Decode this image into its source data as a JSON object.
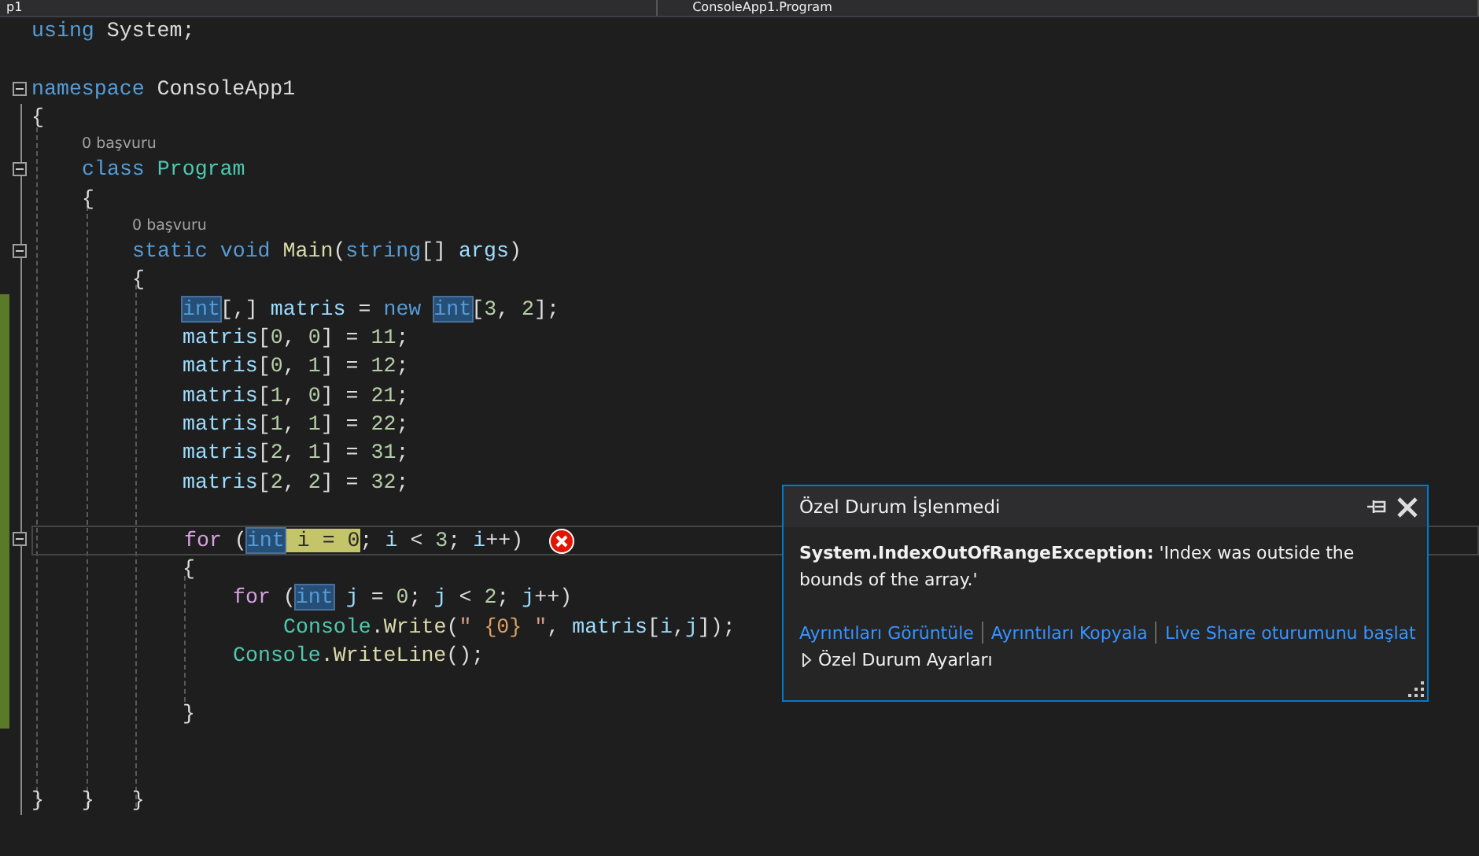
{
  "nav_bar": {
    "project": "p1",
    "class": "ConsoleApp1.Program"
  },
  "lines": [
    {
      "kind": "code",
      "changed": false,
      "tokens": [
        {
          "text": "using",
          "kind": "keyword"
        },
        {
          "text": " System;",
          "kind": "plain"
        }
      ]
    },
    {
      "kind": "blank",
      "changed": false
    },
    {
      "kind": "code",
      "expanded": true,
      "changed": false,
      "tokens": [
        {
          "text": "namespace",
          "kind": "keyword"
        },
        {
          "text": " ConsoleApp1",
          "kind": "plain"
        }
      ]
    },
    {
      "kind": "code",
      "changed": false,
      "tokens": [
        {
          "text": "{",
          "kind": "plain"
        }
      ],
      "children": [
        {
          "kind": "codelens",
          "changed": false,
          "text": "0 başvuru"
        },
        {
          "kind": "code",
          "expanded": true,
          "changed": false,
          "tokens": [
            {
              "text": "class",
              "kind": "keyword"
            },
            {
              "text": " Program",
              "kind": "type"
            }
          ]
        },
        {
          "kind": "code",
          "changed": false,
          "tokens": [
            {
              "text": "{",
              "kind": "plain"
            }
          ],
          "children": [
            {
              "kind": "codelens",
              "changed": false,
              "text": "0 başvuru"
            },
            {
              "kind": "code",
              "expanded": true,
              "changed": false,
              "tokens": [
                {
                  "text": "static void",
                  "kind": "keyword"
                },
                {
                  "text": " Main",
                  "kind": "method"
                },
                {
                  "text": "(",
                  "kind": "plain"
                },
                {
                  "text": "string",
                  "kind": "keyword"
                },
                {
                  "text": "[] ",
                  "kind": "plain"
                },
                {
                  "text": "args",
                  "kind": "ident"
                },
                {
                  "text": ")",
                  "kind": "plain"
                }
              ]
            },
            {
              "kind": "code",
              "changed": false,
              "tokens": [
                {
                  "text": "{",
                  "kind": "plain"
                }
              ],
              "children": [
                {
                  "kind": "code",
                  "changed": true,
                  "tokens": [
                    {
                      "text": "int",
                      "kind": "reference"
                    },
                    {
                      "text": "[,] ",
                      "kind": "plain"
                    },
                    {
                      "text": "matris",
                      "kind": "ident"
                    },
                    {
                      "text": " = ",
                      "kind": "plain"
                    },
                    {
                      "text": "new ",
                      "kind": "keyword"
                    },
                    {
                      "text": "int",
                      "kind": "reference"
                    },
                    {
                      "text": "[",
                      "kind": "plain"
                    },
                    {
                      "text": "3",
                      "kind": "number"
                    },
                    {
                      "text": ", ",
                      "kind": "plain"
                    },
                    {
                      "text": "2",
                      "kind": "number"
                    },
                    {
                      "text": "];",
                      "kind": "plain"
                    }
                  ]
                },
                {
                  "kind": "code",
                  "changed": true,
                  "tokens": [
                    {
                      "text": "matris",
                      "kind": "ident"
                    },
                    {
                      "text": "[",
                      "kind": "plain"
                    },
                    {
                      "text": "0",
                      "kind": "number"
                    },
                    {
                      "text": ", ",
                      "kind": "plain"
                    },
                    {
                      "text": "0",
                      "kind": "number"
                    },
                    {
                      "text": "] = ",
                      "kind": "plain"
                    },
                    {
                      "text": "11",
                      "kind": "number"
                    },
                    {
                      "text": ";",
                      "kind": "plain"
                    }
                  ]
                },
                {
                  "kind": "code",
                  "changed": true,
                  "tokens": [
                    {
                      "text": "matris",
                      "kind": "ident"
                    },
                    {
                      "text": "[",
                      "kind": "plain"
                    },
                    {
                      "text": "0",
                      "kind": "number"
                    },
                    {
                      "text": ", ",
                      "kind": "plain"
                    },
                    {
                      "text": "1",
                      "kind": "number"
                    },
                    {
                      "text": "] = ",
                      "kind": "plain"
                    },
                    {
                      "text": "12",
                      "kind": "number"
                    },
                    {
                      "text": ";",
                      "kind": "plain"
                    }
                  ]
                },
                {
                  "kind": "code",
                  "changed": true,
                  "tokens": [
                    {
                      "text": "matris",
                      "kind": "ident"
                    },
                    {
                      "text": "[",
                      "kind": "plain"
                    },
                    {
                      "text": "1",
                      "kind": "number"
                    },
                    {
                      "text": ", ",
                      "kind": "plain"
                    },
                    {
                      "text": "0",
                      "kind": "number"
                    },
                    {
                      "text": "] = ",
                      "kind": "plain"
                    },
                    {
                      "text": "21",
                      "kind": "number"
                    },
                    {
                      "text": ";",
                      "kind": "plain"
                    }
                  ]
                },
                {
                  "kind": "code",
                  "changed": true,
                  "tokens": [
                    {
                      "text": "matris",
                      "kind": "ident"
                    },
                    {
                      "text": "[",
                      "kind": "plain"
                    },
                    {
                      "text": "1",
                      "kind": "number"
                    },
                    {
                      "text": ", ",
                      "kind": "plain"
                    },
                    {
                      "text": "1",
                      "kind": "number"
                    },
                    {
                      "text": "] = ",
                      "kind": "plain"
                    },
                    {
                      "text": "22",
                      "kind": "number"
                    },
                    {
                      "text": ";",
                      "kind": "plain"
                    }
                  ]
                },
                {
                  "kind": "code",
                  "changed": true,
                  "tokens": [
                    {
                      "text": "matris",
                      "kind": "ident"
                    },
                    {
                      "text": "[",
                      "kind": "plain"
                    },
                    {
                      "text": "2",
                      "kind": "number"
                    },
                    {
                      "text": ", ",
                      "kind": "plain"
                    },
                    {
                      "text": "1",
                      "kind": "number"
                    },
                    {
                      "text": "] = ",
                      "kind": "plain"
                    },
                    {
                      "text": "31",
                      "kind": "number"
                    },
                    {
                      "text": ";",
                      "kind": "plain"
                    }
                  ]
                },
                {
                  "kind": "code",
                  "changed": true,
                  "tokens": [
                    {
                      "text": "matris",
                      "kind": "ident"
                    },
                    {
                      "text": "[",
                      "kind": "plain"
                    },
                    {
                      "text": "2",
                      "kind": "number"
                    },
                    {
                      "text": ", ",
                      "kind": "plain"
                    },
                    {
                      "text": "2",
                      "kind": "number"
                    },
                    {
                      "text": "] = ",
                      "kind": "plain"
                    },
                    {
                      "text": "32",
                      "kind": "number"
                    },
                    {
                      "text": ";",
                      "kind": "plain"
                    }
                  ]
                },
                {
                  "kind": "blank",
                  "changed": true
                },
                {
                  "kind": "code",
                  "expanded": true,
                  "changed": true,
                  "current": true,
                  "error": true,
                  "tokens": [
                    {
                      "text": "for",
                      "kind": "control"
                    },
                    {
                      "text": " (",
                      "kind": "plain"
                    },
                    {
                      "text": "int",
                      "kind": "reference"
                    },
                    {
                      "text": " i = 0",
                      "kind": "statement"
                    },
                    {
                      "text": "; ",
                      "kind": "plain"
                    },
                    {
                      "text": "i",
                      "kind": "ident"
                    },
                    {
                      "text": " < ",
                      "kind": "plain"
                    },
                    {
                      "text": "3",
                      "kind": "number"
                    },
                    {
                      "text": "; ",
                      "kind": "plain"
                    },
                    {
                      "text": "i",
                      "kind": "ident"
                    },
                    {
                      "text": "++)",
                      "kind": "plain"
                    }
                  ]
                },
                {
                  "kind": "code",
                  "changed": true,
                  "tokens": [
                    {
                      "text": "{",
                      "kind": "plain"
                    }
                  ],
                  "children": [
                    {
                      "kind": "code",
                      "changed": true,
                      "tokens": [
                        {
                          "text": "for",
                          "kind": "control"
                        },
                        {
                          "text": " (",
                          "kind": "plain"
                        },
                        {
                          "text": "int",
                          "kind": "reference"
                        },
                        {
                          "text": " j",
                          "kind": "ident"
                        },
                        {
                          "text": " = ",
                          "kind": "plain"
                        },
                        {
                          "text": "0",
                          "kind": "number"
                        },
                        {
                          "text": "; ",
                          "kind": "plain"
                        },
                        {
                          "text": "j",
                          "kind": "ident"
                        },
                        {
                          "text": " < ",
                          "kind": "plain"
                        },
                        {
                          "text": "2",
                          "kind": "number"
                        },
                        {
                          "text": "; ",
                          "kind": "plain"
                        },
                        {
                          "text": "j",
                          "kind": "ident"
                        },
                        {
                          "text": "++)",
                          "kind": "plain"
                        }
                      ],
                      "children": [
                        {
                          "kind": "code",
                          "changed": true,
                          "tokens": [
                            {
                              "text": "Console",
                              "kind": "type"
                            },
                            {
                              "text": ".",
                              "kind": "plain"
                            },
                            {
                              "text": "Write",
                              "kind": "method"
                            },
                            {
                              "text": "(",
                              "kind": "plain"
                            },
                            {
                              "text": "\" ",
                              "kind": "string"
                            },
                            {
                              "text": "{0}",
                              "kind": "format"
                            },
                            {
                              "text": " \"",
                              "kind": "string"
                            },
                            {
                              "text": ", ",
                              "kind": "plain"
                            },
                            {
                              "text": "matris",
                              "kind": "ident"
                            },
                            {
                              "text": "[",
                              "kind": "plain"
                            },
                            {
                              "text": "i",
                              "kind": "ident"
                            },
                            {
                              "text": ",",
                              "kind": "plain"
                            },
                            {
                              "text": "j",
                              "kind": "ident"
                            },
                            {
                              "text": "]);",
                              "kind": "plain"
                            }
                          ]
                        }
                      ]
                    },
                    {
                      "kind": "code",
                      "changed": true,
                      "tokens": [
                        {
                          "text": "Console",
                          "kind": "type"
                        },
                        {
                          "text": ".WriteLine",
                          "kind": "method"
                        },
                        {
                          "text": "();",
                          "kind": "plain"
                        }
                      ]
                    },
                    {
                      "kind": "blank",
                      "changed": true
                    }
                  ]
                },
                {
                  "kind": "code",
                  "changed": true,
                  "tokens": [
                    {
                      "text": "}",
                      "kind": "plain"
                    }
                  ]
                }
              ]
            }
          ]
        }
      ]
    },
    {
      "kind": "blank",
      "changed": false
    },
    {
      "kind": "blank",
      "changed": false
    },
    {
      "kind": "code",
      "changed": false,
      "tokens": [
        {
          "text": "}   }   }",
          "kind": "plain"
        }
      ]
    }
  ],
  "exception_popup": {
    "title": "Özel Durum İşlenmedi",
    "message": "**System.IndexOutOfRangeException:** 'Index was outside the bounds of the array.'",
    "links": [
      "Ayrıntıları Görüntüle",
      "Ayrıntıları Kopyala",
      "Live Share oturumunu başlat"
    ],
    "settings": {
      "label": "Özel Durum Ayarları",
      "expanded": false
    }
  }
}
